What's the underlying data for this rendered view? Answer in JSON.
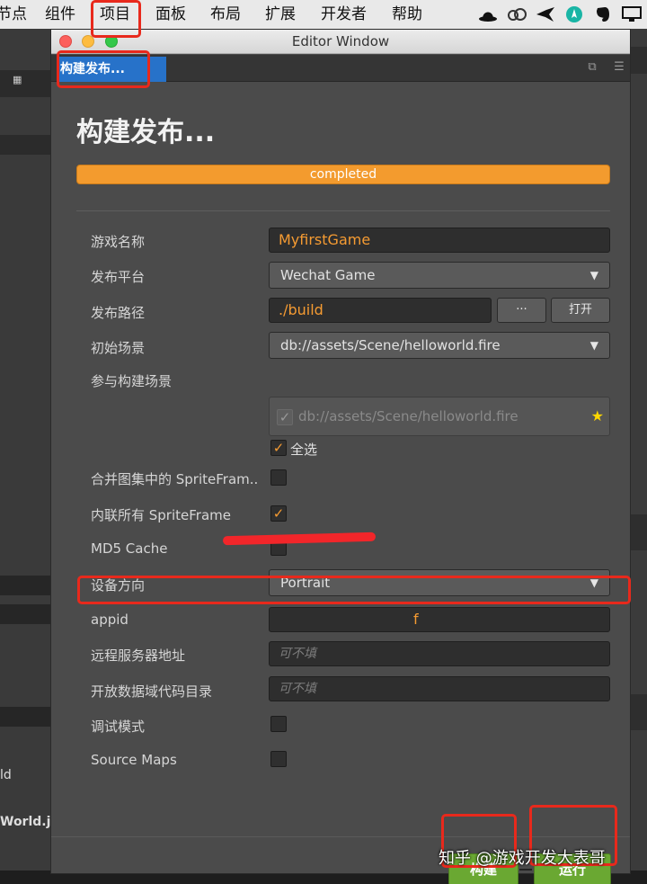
{
  "menubar": {
    "items": [
      {
        "label": "节点"
      },
      {
        "label": "组件"
      },
      {
        "label": "项目"
      },
      {
        "label": "面板"
      },
      {
        "label": "布局"
      },
      {
        "label": "扩展"
      },
      {
        "label": "开发者"
      },
      {
        "label": "帮助"
      }
    ],
    "tray_icons": [
      "bowler-hat-icon",
      "creative-cloud-icon",
      "bird-icon",
      "location-icon",
      "evernote-icon",
      "display-icon"
    ]
  },
  "background": {
    "left_texts": [
      "ld",
      "World.js"
    ]
  },
  "window": {
    "title": "Editor Window",
    "tab_label": "构建发布...",
    "page_title": "构建发布...",
    "progress_text": "completed",
    "progress_fraction": 1.0,
    "fields": {
      "game_name_label": "游戏名称",
      "game_name_value": "MyfirstGame",
      "platform_label": "发布平台",
      "platform_value": "Wechat Game",
      "path_label": "发布路径",
      "path_value": "./build",
      "path_browse_label": "···",
      "path_open_label": "打开",
      "start_scene_label": "初始场景",
      "start_scene_value": "db://assets/Scene/helloworld.fire",
      "build_scenes_label": "参与构建场景",
      "build_scene_item": "db://assets/Scene/helloworld.fire",
      "select_all_label": "全选",
      "merge_sprite_label": "合并图集中的 SpriteFram..",
      "inline_sprite_label": "内联所有 SpriteFrame",
      "md5_label": "MD5 Cache",
      "orientation_label": "设备方向",
      "orientation_value": "Portrait",
      "appid_label": "appid",
      "appid_value": "f",
      "remote_server_label": "远程服务器地址",
      "remote_server_placeholder": "可不填",
      "open_data_label": "开放数据域代码目录",
      "open_data_placeholder": "可不填",
      "debug_label": "调试模式",
      "sourcemaps_label": "Source Maps"
    },
    "checks": {
      "select_all": true,
      "merge_sprite": false,
      "inline_sprite": true,
      "md5": false,
      "debug": false,
      "sourcemaps": false
    },
    "buttons": {
      "build_label": "构建",
      "run_label": "运行"
    }
  },
  "watermark": "知乎 @游戏开发大表哥",
  "colors": {
    "accent_orange": "#f39b2e",
    "tab_blue": "#2772c9",
    "button_green": "#6aa832",
    "highlight_red": "#e8291c"
  }
}
